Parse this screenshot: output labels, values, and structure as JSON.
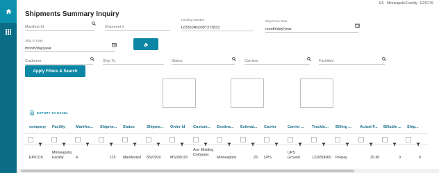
{
  "topbar": {
    "context": "ES · Minneapolis Facility · EPICOS"
  },
  "page": {
    "title": "Shipments Summary Inquiry"
  },
  "filters": {
    "manifest_id": {
      "placeholder": "Manifest Id",
      "value": ""
    },
    "shipment_num": {
      "placeholder": "Shipment #",
      "value": ""
    },
    "tracking_number": {
      "label": "Tracking Number",
      "value": "1Z2650R60397373832"
    },
    "ship_from_date": {
      "label": "Ship From Date",
      "value": "month/day/year"
    },
    "ship_to_date": {
      "label": "Ship To Date",
      "value": "month/day/year"
    },
    "customer": {
      "placeholder": "Customer",
      "value": ""
    },
    "ship_to": {
      "placeholder": "Ship To",
      "value": ""
    },
    "status": {
      "placeholder": "Status",
      "value": ""
    },
    "carriers": {
      "placeholder": "Carriers",
      "value": ""
    },
    "facilities": {
      "placeholder": "Facilities",
      "value": ""
    }
  },
  "actions": {
    "apply_label": "Apply Filters & Search",
    "export_label": "EXPORT TO EXCEL"
  },
  "grid": {
    "columns": [
      "company",
      "Facility",
      "Manifes...",
      "Shipme...",
      "Status",
      "Shipme...",
      "Order Id",
      "Custom...",
      "Destina...",
      "Estimat...",
      "Carrier",
      "Carrier ...",
      "Trackin...",
      "Billing ...",
      "Actual F...",
      "Billable ...",
      "Ship..."
    ],
    "rows": [
      {
        "company": "EPICOS",
        "facility": "Minneapolis Facility",
        "manifest": "4",
        "shipment": "115",
        "status": "Manifested",
        "ship_date": "8/9/2020",
        "order_id": "MS000115",
        "customer": "Ace Molding Company",
        "destination": "Minneapolis",
        "estimated": "25",
        "carrier": "UPS",
        "carrier_service": "UPS Ground",
        "tracking": "1Z2650R60",
        "billing": "Prepay",
        "actual_freight": "25.36",
        "billable": "0",
        "ship": "0"
      }
    ]
  }
}
